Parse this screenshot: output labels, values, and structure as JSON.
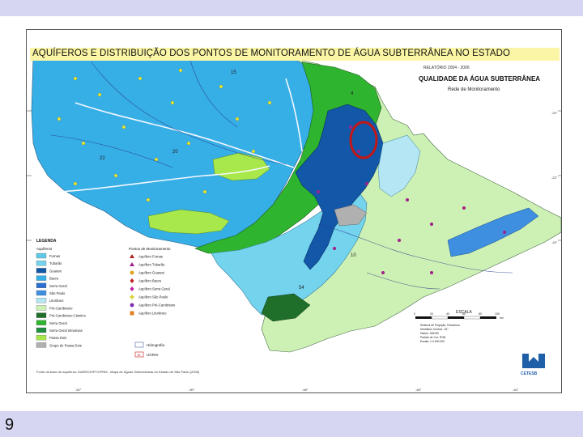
{
  "slide": {
    "number": "9",
    "title": "AQUÍFEROS E DISTRIBUIÇÃO DOS PONTOS DE MONITORAMENTO DE ÁGUA SUBTERRÂNEA NO ESTADO"
  },
  "map": {
    "header_small": "RELATÓRIO 2004 - 2006",
    "header_title": "QUALIDADE DA ÁGUA SUBTERRÂNEA",
    "header_subtitle": "Rede de Monitoramento",
    "legend_title": "LEGENDA",
    "aquifers_title": "Aquíferos",
    "aquifers": [
      {
        "label": "Furnas",
        "color": "#5ec8e6"
      },
      {
        "label": "Tubarão",
        "color": "#74d4ee"
      },
      {
        "label": "Guarani",
        "color": "#1257a8"
      },
      {
        "label": "Bauru",
        "color": "#36aee6"
      },
      {
        "label": "Serra Geral",
        "color": "#2a6fd1"
      },
      {
        "label": "São Paulo",
        "color": "#3f8fe0"
      },
      {
        "label": "Litorâneo",
        "color": "#b4e6f4"
      },
      {
        "label": "Pré-Cambriano",
        "color": "#cdf1b4"
      },
      {
        "label": "Pré-Cambriano Cárstico",
        "color": "#1f6e2a"
      },
      {
        "label": "Serra Geral",
        "color": "#2fb42f"
      },
      {
        "label": "Serra Geral Intrusivas",
        "color": "#1f8f3f"
      },
      {
        "label": "Passa Dois",
        "color": "#a9e84a"
      },
      {
        "label": "Grupo de Passa Dois",
        "color": "#b0b0b0"
      }
    ],
    "points_title": "Pontos de Monitoramento",
    "points": [
      {
        "label": "Aquífero Furnas",
        "symbol": "triangle",
        "color": "#b02222"
      },
      {
        "label": "Aquífero Tubarão",
        "symbol": "triangle",
        "color": "#a0208a"
      },
      {
        "label": "Aquífero Guarani",
        "symbol": "circle",
        "color": "#e0a020"
      },
      {
        "label": "Aquífero Bauru",
        "symbol": "diamond",
        "color": "#c02020"
      },
      {
        "label": "Aquífero Serra Geral",
        "symbol": "diamond",
        "color": "#c020a0"
      },
      {
        "label": "Aquífero São Paulo",
        "symbol": "cross",
        "color": "#d0d020"
      },
      {
        "label": "Aquífero Pré-Cambriano",
        "symbol": "circle",
        "color": "#7a2ab0"
      },
      {
        "label": "Aquífero Litorâneo",
        "symbol": "square",
        "color": "#e08020"
      }
    ],
    "extra_legend": [
      {
        "label": "Hidrografia",
        "symbol": "box"
      },
      {
        "label": "UGRHI",
        "symbol": "box-number",
        "value": "15"
      }
    ],
    "scale_title": "ESCALA",
    "scale_ticks": [
      "0",
      "20",
      "40",
      "60",
      "80",
      "100"
    ],
    "scale_unit": "km",
    "projection_note": "Sistema de Projeção: Policônica\nMeridiano Central: -51°\nDatum: SAD69\nPadrão de Cor: RGB\nEscala: 1:4.000.000",
    "source_note": "Fonte da base de aquíferos: DAEE/IG/IPT/CPRM - Mapa de Águas Subterrâneas do Estado de São Paulo (2005)",
    "logo_text": "CETESB",
    "ugrhi_labels": [
      "15",
      "20",
      "22",
      "4",
      "10",
      "54"
    ],
    "coord_labels": [
      "-52°",
      "-50°",
      "-48°",
      "-46°",
      "-44°"
    ],
    "lat_labels": [
      "-20°",
      "-22°",
      "-24°"
    ],
    "colors": {
      "bauru": "#36aee6",
      "serra_geral": "#2fb42f",
      "guarani": "#1257a8",
      "tubarao": "#74d4ee",
      "pre_cambriano": "#cdf1b4",
      "highlight_circle": "#c01818"
    }
  }
}
